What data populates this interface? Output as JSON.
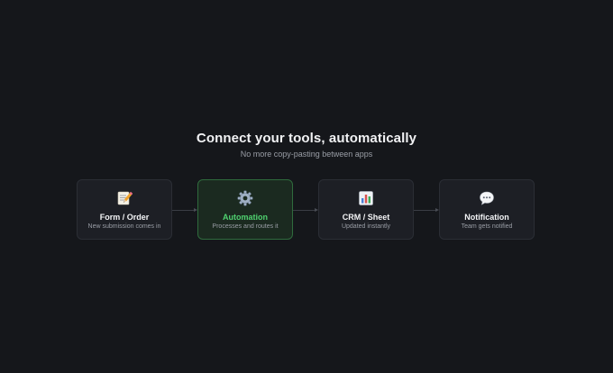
{
  "header": {
    "title": "Connect your tools, automatically",
    "subtitle": "No more copy-pasting between apps"
  },
  "flow": {
    "steps": [
      {
        "icon": "memo-pencil-icon",
        "label": "Form / Order",
        "description": "New submission comes in",
        "active": false
      },
      {
        "icon": "gear-icon",
        "label": "Automation",
        "description": "Processes and routes it",
        "active": true
      },
      {
        "icon": "bar-chart-icon",
        "label": "CRM / Sheet",
        "description": "Updated instantly",
        "active": false
      },
      {
        "icon": "speech-bubble-icon",
        "label": "Notification",
        "description": "Team gets notified",
        "active": false
      }
    ]
  },
  "colors": {
    "background": "#15171b",
    "card": "#1d1f25",
    "active_card": "#1b2a20",
    "active_border": "#2f6b3d",
    "active_text": "#4fd16f"
  }
}
